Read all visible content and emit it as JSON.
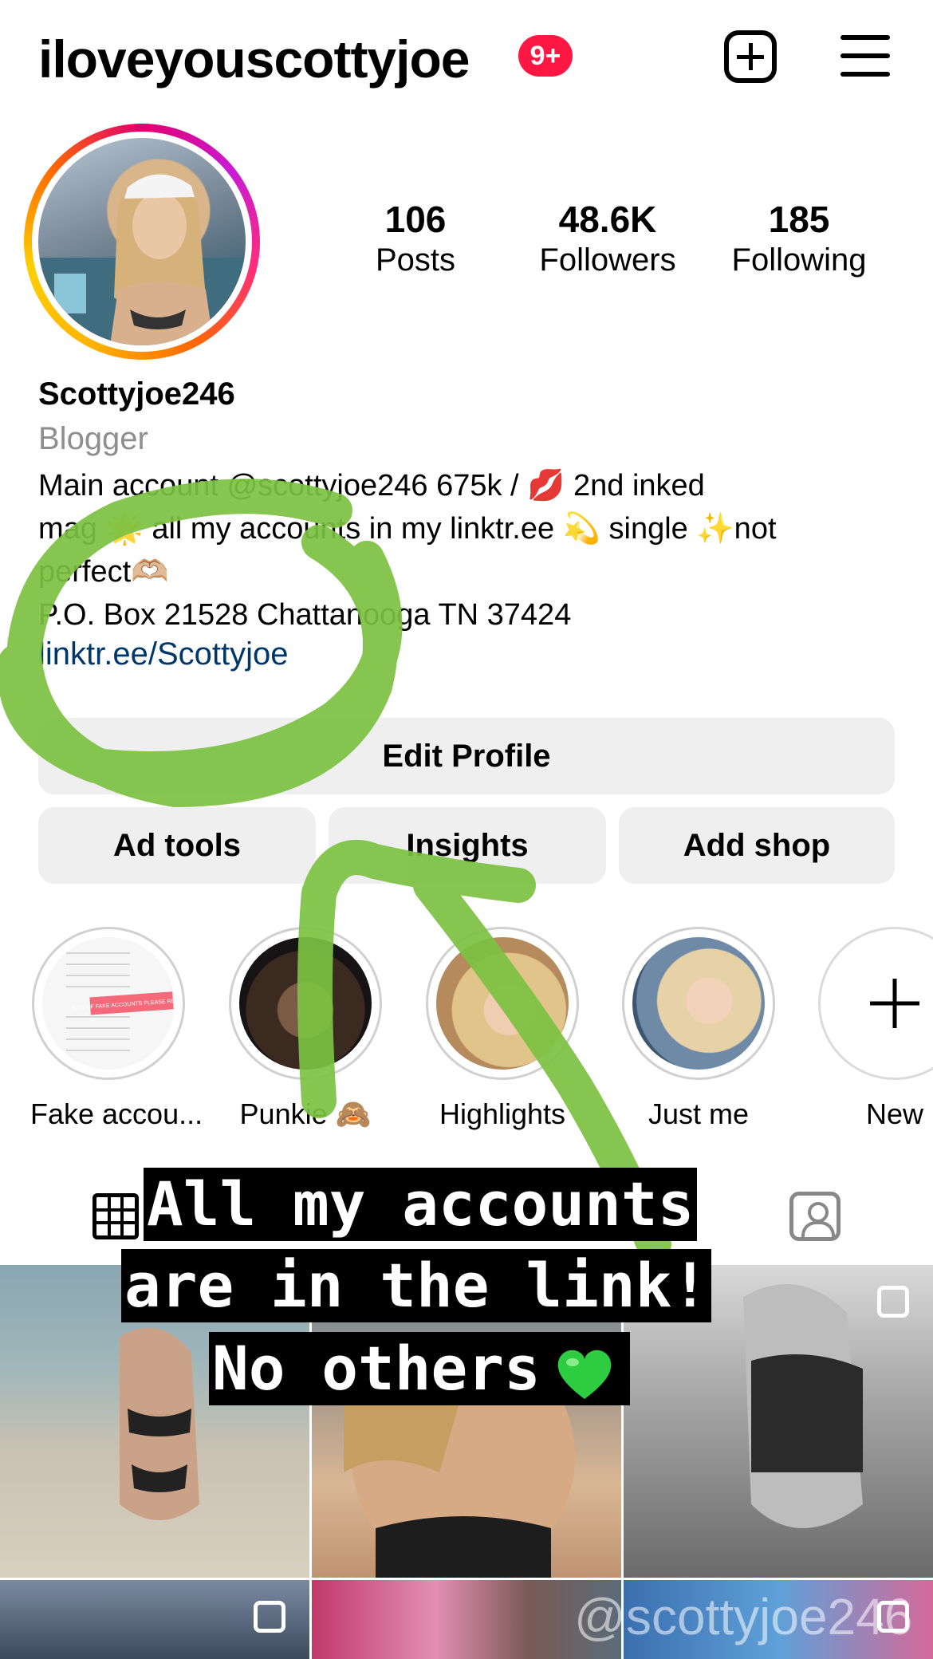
{
  "header": {
    "username": "iloveyouscottyjoe",
    "notification_badge": "9+",
    "add_icon": "plus-square-icon",
    "menu_icon": "hamburger-menu-icon"
  },
  "profile": {
    "stats": [
      {
        "value": "106",
        "label": "Posts"
      },
      {
        "value": "48.6K",
        "label": "Followers"
      },
      {
        "value": "185",
        "label": "Following"
      }
    ],
    "display_name": "Scottyjoe246",
    "category": "Blogger",
    "bio_lines": [
      "Main account @scottyjoe246 675k / 💋  2nd inked",
      "mag 🌟 all my accounts in my linktr.ee 💫 single ✨not",
      "perfect🫶🏼",
      "P.O. Box 21528 Chattanooga TN 37424"
    ],
    "link": "linktr.ee/Scottyjoe"
  },
  "buttons": {
    "edit_profile": "Edit Profile",
    "ad_tools": "Ad tools",
    "insights": "Insights",
    "add_shop": "Add shop"
  },
  "highlights": [
    {
      "label": "Fake accou...",
      "thumb_text": "LIST OF FAKE ACCOUNTS PLEASE REPORT"
    },
    {
      "label": "Punkie 🙈"
    },
    {
      "label": "Highlights"
    },
    {
      "label": "Just me"
    },
    {
      "label": "New"
    }
  ],
  "tabs": {
    "grid_icon": "grid-icon",
    "tagged_icon": "tagged-person-icon"
  },
  "overlay": {
    "line1": "All my accounts",
    "line2": "are in the link!",
    "line3": "No others"
  },
  "watermark": "@scottyjoe246",
  "colors": {
    "badge": "#ff1744",
    "link": "#00376b",
    "button_bg": "#efefef",
    "scribble": "#7cc242",
    "muted": "#8e8e8e"
  }
}
